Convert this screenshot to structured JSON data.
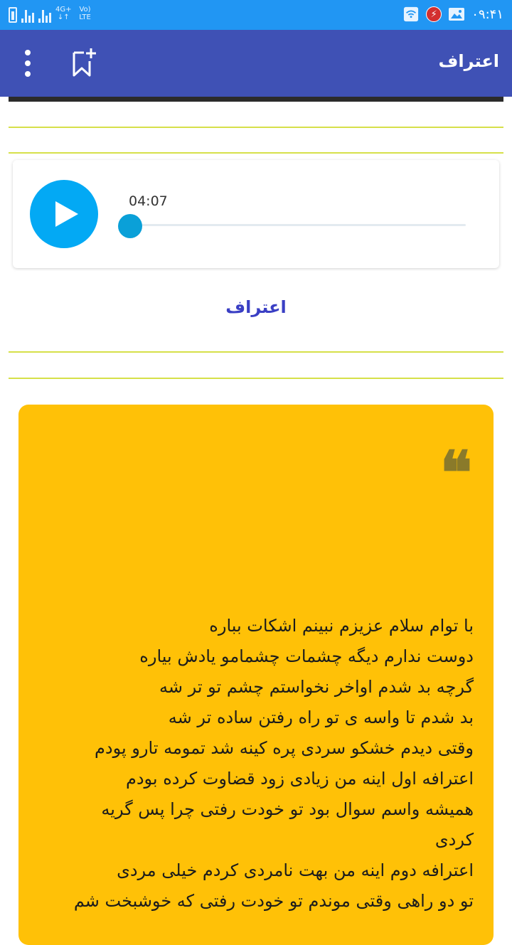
{
  "status_bar": {
    "network_label": "4G+",
    "network_label2": "Vo) LTE",
    "time": "۰۹:۴۱"
  },
  "app_bar": {
    "title": "اعتراف"
  },
  "audio_player": {
    "duration": "04:07",
    "progress": 0
  },
  "section": {
    "title": "اعتراف"
  },
  "quote": {
    "mark": "❝",
    "lines": [
      "با توام سلام عزیزم نبینم اشکات بباره",
      "دوست ندارم دیگه چشمات چشمامو یادش بیاره",
      "گرچه بد شدم اواخر نخواستم چشم تو تر شه",
      "بد شدم تا واسه ی تو راه رفتن ساده تر شه",
      "وقتی دیدم خشکو سردی پره کینه شد تمومه تارو پودم",
      "اعترافه اول اینه من زیادی زود قضاوت کرده بودم",
      "همیشه واسم سوال بود تو خودت رفتی چرا پس گریه",
      "کردی",
      "اعترافه دوم اینه من بهت نامردی کردم خیلی مردی",
      "تو دو راهی وقتی موندم تو خودت رفتی که خوشبخت شم"
    ]
  },
  "colors": {
    "status_bar": "#2196F3",
    "app_bar": "#3F51B5",
    "accent_blue": "#03A9F4",
    "quote_bg": "#FFC107",
    "divider": "#d6e04a"
  }
}
